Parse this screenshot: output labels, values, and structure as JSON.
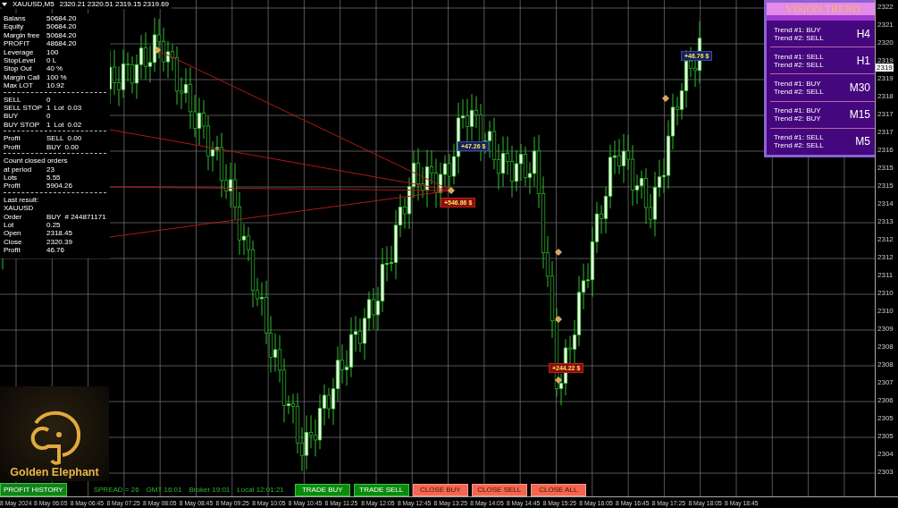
{
  "header": {
    "symbol": "XAUUSD,M5",
    "prices": "2320.21 2320.51 2319.15 2319.69"
  },
  "info_panel": {
    "sections": [
      [
        [
          "Balans",
          "50684.20"
        ],
        [
          "Equity",
          "50684.20"
        ],
        [
          "Margin free",
          "50684.20"
        ],
        [
          "PROFIT",
          "48684.20"
        ],
        [
          "Leverage",
          "100"
        ],
        [
          "StopLevel",
          "0 L"
        ],
        [
          "Stop Out",
          "40 %"
        ],
        [
          "Margin Call",
          "100 %"
        ],
        [
          "Max LOT",
          "10.92"
        ]
      ],
      [
        [
          "SELL",
          "0"
        ],
        [
          "SELL STOP",
          "1",
          "Lot",
          "0.03"
        ],
        [
          "BUY",
          "0"
        ],
        [
          "BUY STOP",
          "1",
          "Lot",
          "0.02"
        ]
      ],
      [
        [
          "Profit",
          "SELL",
          "0.00"
        ],
        [
          "Profit",
          "BUY",
          "0.00"
        ]
      ],
      [
        [
          "Count closed orders"
        ],
        [
          "at period",
          "23"
        ],
        [
          "Lots",
          "5.55"
        ],
        [
          "Profit",
          "5904.26"
        ]
      ],
      [
        [
          "Last result:"
        ],
        [
          "XAUUSD"
        ],
        [
          "Order",
          "BUY",
          "# 244871171"
        ],
        [
          "Lot",
          "0.25"
        ],
        [
          "Open",
          "2318.45"
        ],
        [
          "Close",
          "2320.39"
        ],
        [
          "Profit",
          "46.76"
        ]
      ]
    ]
  },
  "vision_trend": {
    "title": "VISION TREND",
    "items": [
      {
        "trend_1": "Trend #1: BUY",
        "trend_2": "Trend #2: SELL",
        "timeframe": "H4"
      },
      {
        "trend_1": "Trend #1: SELL",
        "trend_2": "Trend #2: SELL",
        "timeframe": "H1"
      },
      {
        "trend_1": "Trend #1: BUY",
        "trend_2": "Trend #2: SELL",
        "timeframe": "M30"
      },
      {
        "trend_1": "Trend #1: BUY",
        "trend_2": "Trend #2: BUY",
        "timeframe": "M15"
      },
      {
        "trend_1": "Trend #1: SELL",
        "trend_2": "Trend #2: SELL",
        "timeframe": "M5"
      }
    ]
  },
  "profit_labels": [
    {
      "text": "+47.26 $",
      "kind": "buy"
    },
    {
      "text": "+546.86 $",
      "kind": "sell"
    },
    {
      "text": "+244.22 $",
      "kind": "sell"
    },
    {
      "text": "+46.76 $",
      "kind": "buy"
    }
  ],
  "logo": {
    "name": "Golden Elephant"
  },
  "bottom_bar": {
    "history_button": "PROFIT HISTORY",
    "status": [
      "SPREAD = 26",
      "GMT 16:01",
      "Broker 19:01",
      "Local 12:01:21"
    ],
    "buttons": [
      {
        "label": "TRADE BUY",
        "kind": "trade"
      },
      {
        "label": "TRADE SELL",
        "kind": "trade"
      },
      {
        "label": "CLOSE BUY",
        "kind": "close"
      },
      {
        "label": "CLOSE SELL",
        "kind": "close"
      },
      {
        "label": "CLOSE ALL",
        "kind": "close"
      }
    ]
  },
  "price_axis": {
    "labels": [
      "2322",
      "2321",
      "2320",
      "2319",
      "2319",
      "2318",
      "2317",
      "2317",
      "2316",
      "2315",
      "2315",
      "2314",
      "2313",
      "2312",
      "2312",
      "2311",
      "2310",
      "2310",
      "2309",
      "2308",
      "2308",
      "2307",
      "2306",
      "2305",
      "2305",
      "2304",
      "2303"
    ],
    "current_price": "2319"
  },
  "time_axis": [
    "8 May 2024",
    "8 May 06:05",
    "8 May 06:45",
    "8 May 07:25",
    "8 May 08:05",
    "8 May 08:45",
    "8 May 09:25",
    "8 May 10:05",
    "8 May 10:45",
    "8 May 11:25",
    "8 May 12:05",
    "8 May 12:45",
    "8 May 13:25",
    "8 May 14:05",
    "8 May 14:45",
    "8 May 15:25",
    "8 May 16:05",
    "8 May 16:45",
    "8 May 17:25",
    "8 May 18:05",
    "8 May 18:45"
  ]
}
